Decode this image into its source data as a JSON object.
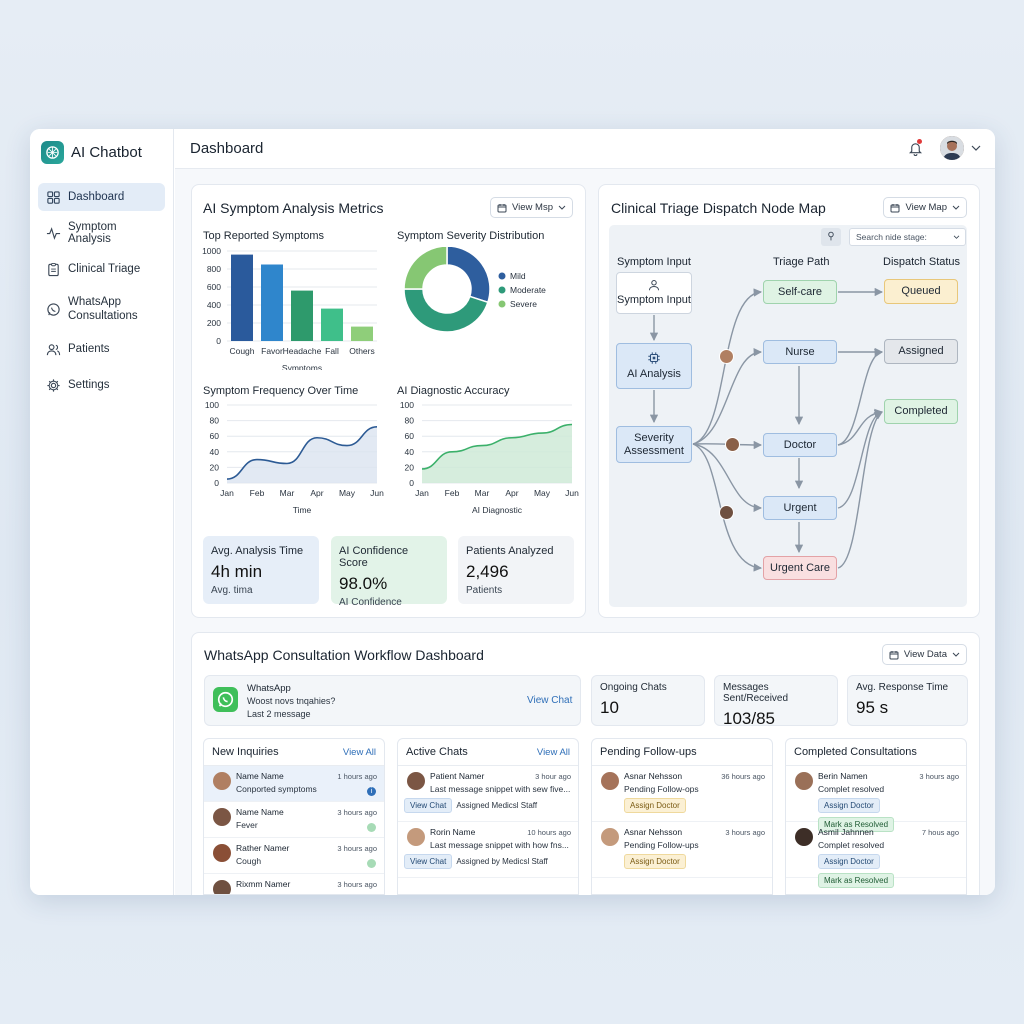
{
  "app": {
    "name": "AI Chatbot"
  },
  "sidebar": {
    "items": [
      {
        "label": "Dashboard",
        "icon": "grid-icon"
      },
      {
        "label": "Symptom Analysis",
        "icon": "pulse-icon"
      },
      {
        "label": "Clinical Triage",
        "icon": "clipboard-icon"
      },
      {
        "label": "WhatsApp Consultations",
        "icon": "whatsapp-icon"
      },
      {
        "label": "Patients",
        "icon": "users-icon"
      },
      {
        "label": "Settings",
        "icon": "gear-icon"
      }
    ]
  },
  "header": {
    "title": "Dashboard"
  },
  "metrics": {
    "title": "AI Symptom Analysis Metrics",
    "button": "View Msp",
    "kpis": [
      {
        "label": "Avg. Analysis Time",
        "value": "4h min",
        "sub": "Avg. tima"
      },
      {
        "label": "AI Confidence Score",
        "value": "98.0%",
        "sub": "AI Confidence"
      },
      {
        "label": "Patients Analyzed",
        "value": "2,496",
        "sub": "Patients"
      }
    ]
  },
  "chart_data": [
    {
      "type": "bar",
      "title": "Top Reported Symptoms",
      "categories": [
        "Cough",
        "Favor",
        "Headache",
        "Fall",
        "Others"
      ],
      "values": [
        960,
        850,
        560,
        360,
        160
      ],
      "xlabel": "Symptoms",
      "ylabel": "",
      "ylim": [
        0,
        1000
      ],
      "yticks": [
        1000,
        800,
        600,
        400,
        200,
        0
      ],
      "colors": [
        "#2a5a9c",
        "#2f86cc",
        "#2e9a6c",
        "#3fbf8a",
        "#8fce7a"
      ]
    },
    {
      "type": "pie",
      "title": "Symptom Severity Distribution",
      "slices": [
        {
          "label": "Mild",
          "value": 30,
          "color": "#2e5e9e"
        },
        {
          "label": "Moderate",
          "value": 45,
          "color": "#2e9a7a"
        },
        {
          "label": "Severe",
          "value": 25,
          "color": "#86c773"
        }
      ],
      "donut": true
    },
    {
      "type": "line",
      "title": "Symptom Frequency Over Time",
      "categories": [
        "Jan",
        "Feb",
        "Mar",
        "Apr",
        "May",
        "Jun"
      ],
      "values": [
        5,
        30,
        25,
        58,
        48,
        72
      ],
      "xlabel": "Time",
      "ylim": [
        0,
        100
      ],
      "yticks": [
        100,
        80,
        60,
        40,
        20,
        0
      ],
      "color": "#2c5a94"
    },
    {
      "type": "area",
      "title": "AI Diagnostic Accuracy",
      "categories": [
        "Jan",
        "Feb",
        "Mar",
        "Apr",
        "May",
        "Jun"
      ],
      "values": [
        18,
        40,
        48,
        58,
        64,
        75
      ],
      "xlabel": "AI Diagnostic",
      "ylim": [
        0,
        100
      ],
      "yticks": [
        100,
        80,
        60,
        40,
        20,
        0
      ],
      "color": "#3bb06a"
    }
  ],
  "triage": {
    "title": "Clinical Triage Dispatch Node Map",
    "button": "View Map",
    "search_placeholder": "Search nide stage:",
    "columns": [
      "Symptom Input",
      "Triage Path",
      "Dispatch Status"
    ],
    "inputs": [
      "Symptom Input",
      "AI Analysis",
      "Severity Assessment"
    ],
    "paths": [
      "Self-care",
      "Nurse",
      "Doctor",
      "Urgent",
      "Urgent Care"
    ],
    "statuses": [
      "Queued",
      "Assigned",
      "Completed"
    ]
  },
  "whatsapp": {
    "title": "WhatsApp Consultation Workflow Dashboard",
    "button": "View Data",
    "card": {
      "name": "WhatsApp",
      "line1": "Woost novs tnqahies?",
      "line2": "Last 2 message",
      "action": "View Chat"
    },
    "stats": [
      {
        "label": "Ongoing Chats",
        "value": "10"
      },
      {
        "label": "Messages Sent/Received",
        "value": "103/85"
      },
      {
        "label": "Avg. Response Time",
        "value": "95 s"
      }
    ],
    "columns": [
      {
        "title": "New Inquiries",
        "link": "View All",
        "rows": [
          {
            "name": "Name Name",
            "desc": "Conported symptoms",
            "time": "1 hours ago",
            "ind": "#2f6fb8"
          },
          {
            "name": "Name Name",
            "desc": "Fever",
            "time": "3 hours ago",
            "ind": "#a7dbb6"
          },
          {
            "name": "Rather Namer",
            "desc": "Cough",
            "time": "3 hours ago",
            "ind": "#a7dbb6"
          },
          {
            "name": "Rixmm Namer",
            "desc": "",
            "time": "3 hours ago",
            "ind": ""
          }
        ]
      },
      {
        "title": "Active Chats",
        "link": "View All",
        "rows": [
          {
            "name": "Patient Namer",
            "desc": "Last message snippet with sew five...",
            "time": "3 hour ago",
            "chip": "View Chat",
            "extra": "Assigned Medicsl Staff"
          },
          {
            "name": "Rorin Name",
            "desc": "Last message snippet with how fns...",
            "time": "10 hours ago",
            "chip": "View Chat",
            "extra": "Assigned by Medicsl Staff"
          }
        ]
      },
      {
        "title": "Pending Follow-ups",
        "link": "",
        "rows": [
          {
            "name": "Asnar Nehsson",
            "desc": "Pending Follow-ops",
            "time": "36 hours ago",
            "chip": "Assign Doctor"
          },
          {
            "name": "Asnar Nehsson",
            "desc": "Pending Follow-ups",
            "time": "3 hours ago",
            "chip": "Assign Doctor"
          }
        ]
      },
      {
        "title": "Completed Consultations",
        "link": "",
        "rows": [
          {
            "name": "Berin Namen",
            "desc": "Complet resolved",
            "time": "3 hours ago",
            "chip": "Assign Doctor",
            "chip2": "Mark as Resolved"
          },
          {
            "name": "Asmil Jahnnen",
            "desc": "Complet resolved",
            "time": "7 hous ago",
            "chip": "Assign Doctor",
            "chip2": "Mark as Resolved"
          }
        ]
      }
    ]
  }
}
